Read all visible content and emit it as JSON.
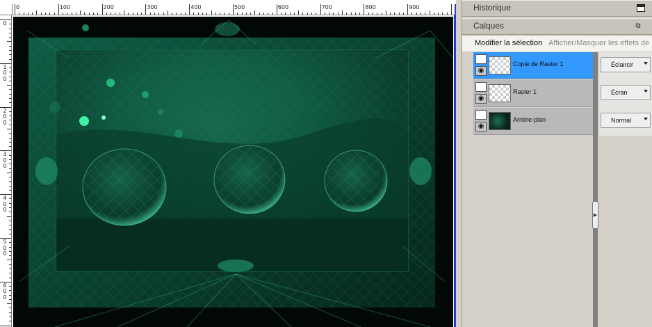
{
  "rulers": {
    "top_labels": [
      "0",
      "100",
      "200",
      "300",
      "400",
      "500",
      "600",
      "700",
      "800",
      "900"
    ],
    "left_labels": [
      [
        "0"
      ],
      [
        "1",
        "0",
        "0"
      ],
      [
        "2",
        "0",
        "0"
      ],
      [
        "3",
        "0",
        "0"
      ],
      [
        "4",
        "0",
        "0"
      ],
      [
        "5",
        "0",
        "0"
      ],
      [
        "6",
        "0",
        "0"
      ]
    ]
  },
  "panels": {
    "historique": {
      "title": "Historique"
    },
    "calques": {
      "title": "Calques",
      "menu": {
        "modify_selection": "Modifier la sélection",
        "toggle_effects": "Afficher/Masquer les effets de"
      },
      "layers": [
        {
          "name": "Copie de Raster 1",
          "selected": true,
          "blend": "Éclaircir"
        },
        {
          "name": "Raster 1",
          "selected": false,
          "blend": "Écran"
        },
        {
          "name": "Arrière-plan",
          "selected": false,
          "blend": "Normal"
        }
      ]
    }
  },
  "colors": {
    "selection": "#3399ff",
    "canvas_frame": "#1e3fd6",
    "artwork_green": "#0d6b4f"
  },
  "icons": [
    "restore-window-icon",
    "float-window-icon",
    "mask-icon",
    "eye-icon",
    "dropdown-arrow-icon",
    "expand-handle-icon"
  ]
}
